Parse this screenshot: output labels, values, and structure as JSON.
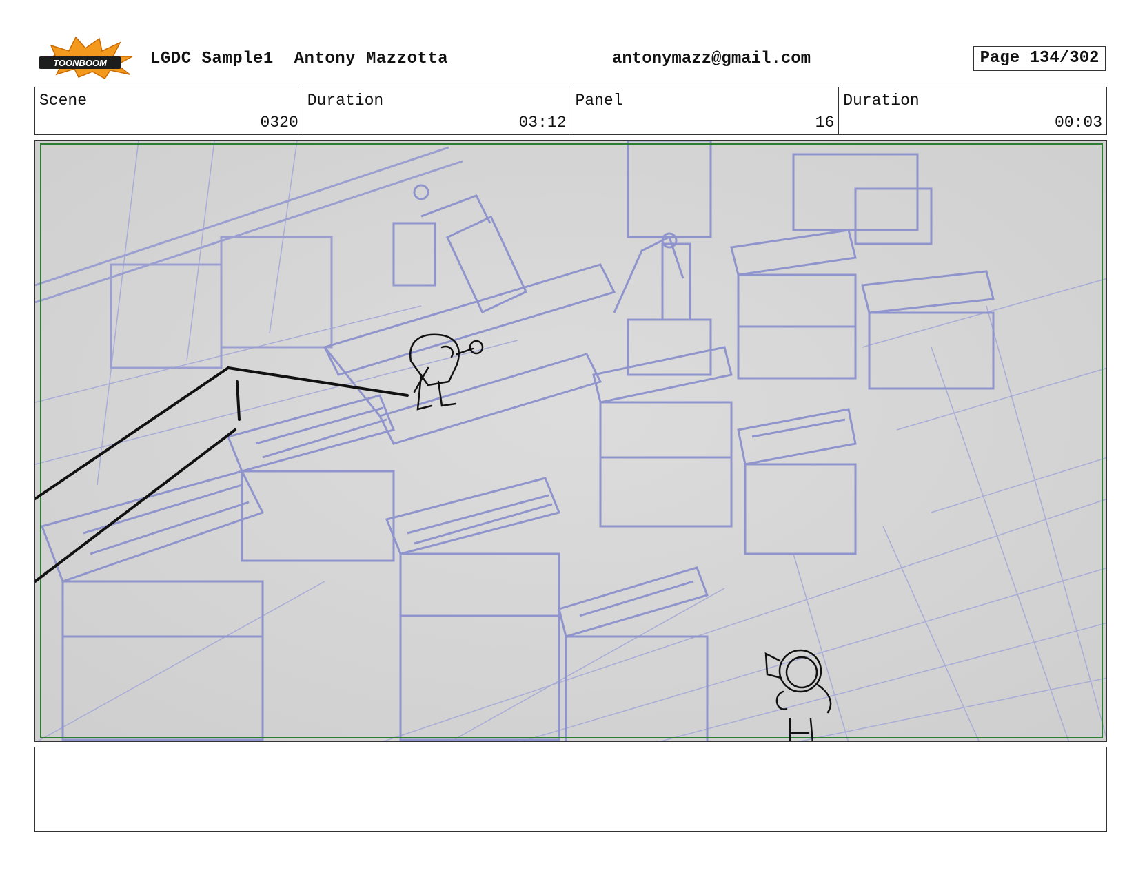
{
  "header": {
    "logo_text": "TOONBOOM",
    "project": "LGDC Sample1",
    "author": "Antony Mazzotta",
    "email": "antonymazz@gmail.com",
    "page": "Page 134/302"
  },
  "info": {
    "scene_label": "Scene",
    "scene_value": "0320",
    "scene_duration_label": "Duration",
    "scene_duration_value": "03:12",
    "panel_label": "Panel",
    "panel_value": "16",
    "panel_duration_label": "Duration",
    "panel_duration_value": "00:03"
  },
  "notes": {
    "text": ""
  },
  "colors": {
    "line_art": "#9a9fd0",
    "background": "#d9d9d9",
    "safe_frame": "#2e7d32",
    "sketch": "#111111",
    "logo_orange": "#f39a1e"
  }
}
